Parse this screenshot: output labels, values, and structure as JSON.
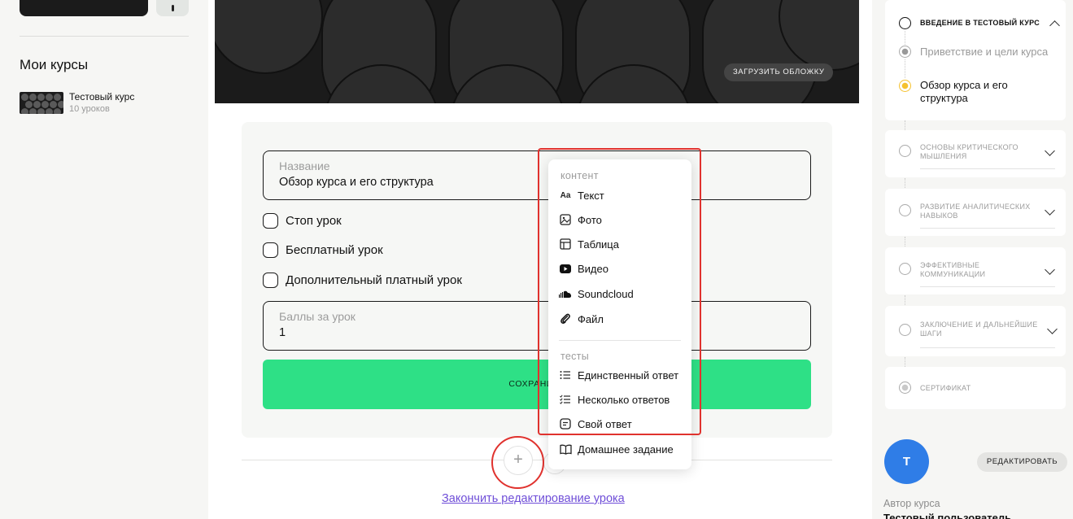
{
  "sidebar": {
    "title": "Мои курсы",
    "courses": [
      {
        "name": "Тестовый курс",
        "lessons": "10 уроков"
      }
    ]
  },
  "cover": {
    "upload_label": "ЗАГРУЗИТЬ ОБЛОЖКУ"
  },
  "lesson_form": {
    "name_label": "Название",
    "name_value": "Обзор курса и его структура",
    "checkboxes": [
      {
        "label": "Стоп урок",
        "checked": false
      },
      {
        "label": "Бесплатный урок",
        "checked": false
      },
      {
        "label": "Дополнительный платный урок",
        "checked": false
      }
    ],
    "points_label": "Баллы за урок",
    "points_value": "1",
    "save_label": "СОХРАНИТЬ"
  },
  "add_menu": {
    "content_heading": "контент",
    "content_items": [
      {
        "label": "Текст",
        "icon": "text-icon"
      },
      {
        "label": "Фото",
        "icon": "image-icon"
      },
      {
        "label": "Таблица",
        "icon": "table-icon"
      },
      {
        "label": "Видео",
        "icon": "video-icon"
      },
      {
        "label": "Soundcloud",
        "icon": "soundcloud-icon"
      },
      {
        "label": "Файл",
        "icon": "paperclip-icon"
      }
    ],
    "tests_heading": "тесты",
    "tests_items": [
      {
        "label": "Единственный ответ",
        "icon": "list-icon"
      },
      {
        "label": "Несколько ответов",
        "icon": "checklist-icon"
      },
      {
        "label": "Свой ответ",
        "icon": "message-icon"
      },
      {
        "label": "Домашнее задание",
        "icon": "book-icon"
      }
    ]
  },
  "add_button_glyph": "+",
  "finish_link": "Закончить редактирование урока",
  "course_outline": {
    "sections": [
      {
        "title": "ВВЕДЕНИЕ В ТЕСТОВЫЙ КУРС",
        "expanded": true,
        "lessons": [
          {
            "title": "Приветствие и цели курса",
            "active": false
          },
          {
            "title": "Обзор курса и его структура",
            "active": true
          }
        ]
      },
      {
        "title": "ОСНОВЫ КРИТИЧЕСКОГО МЫШЛЕНИЯ",
        "expanded": false
      },
      {
        "title": "РАЗВИТИЕ АНАЛИТИЧЕСКИХ НАВЫКОВ",
        "expanded": false
      },
      {
        "title": "ЭФФЕКТИВНЫЕ КОММУНИКАЦИИ",
        "expanded": false
      },
      {
        "title": "ЗАКЛЮЧЕНИЕ И ДАЛЬНЕЙШИЕ ШАГИ",
        "expanded": false
      }
    ],
    "certificate_label": "СЕРТИФИКАТ"
  },
  "author": {
    "initial": "T",
    "edit_label": "РЕДАКТИРОВАТЬ",
    "label": "Автор курса",
    "name": "Тестовый пользователь"
  },
  "colors": {
    "save_button": "#2ee086",
    "active_dot": "#f5c12e",
    "avatar": "#2f7de7",
    "link": "#6f4ed8",
    "highlight": "#e0322e"
  }
}
